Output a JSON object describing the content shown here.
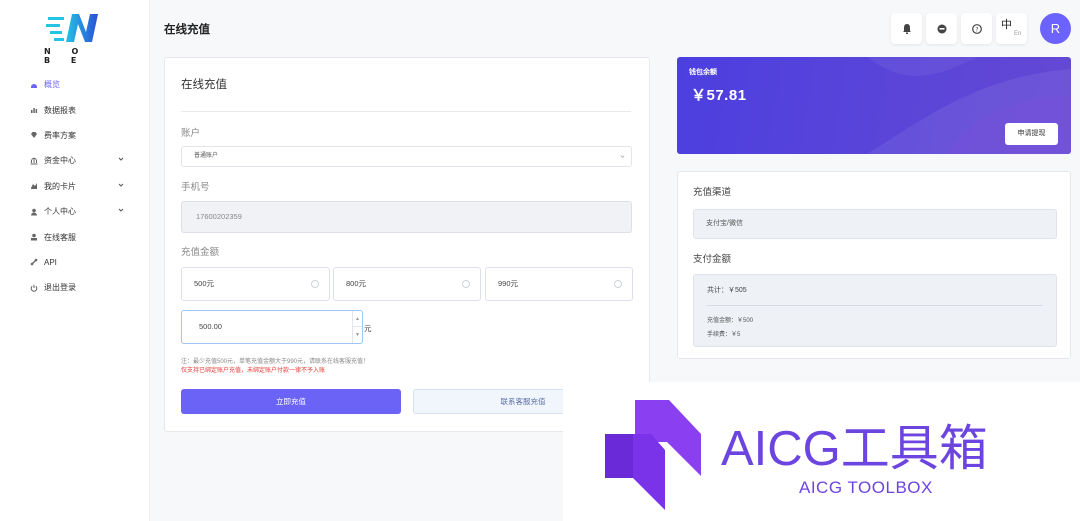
{
  "brand": {
    "logo_text": "N O B E"
  },
  "sidebar": {
    "items": [
      {
        "label": "概览",
        "icon": "dashboard-icon"
      },
      {
        "label": "数据报表",
        "icon": "bar-chart-icon"
      },
      {
        "label": "费率方案",
        "icon": "diamond-icon"
      },
      {
        "label": "资金中心",
        "icon": "bank-icon"
      },
      {
        "label": "我的卡片",
        "icon": "card-icon"
      },
      {
        "label": "个人中心",
        "icon": "user-icon"
      },
      {
        "label": "在线客服",
        "icon": "support-icon"
      },
      {
        "label": "API",
        "icon": "link-icon"
      },
      {
        "label": "退出登录",
        "icon": "power-icon"
      }
    ]
  },
  "header": {
    "title": "在线充值",
    "lang_zh": "中",
    "lang_en": "En",
    "avatar_initial": "R"
  },
  "recharge": {
    "title": "在线充值",
    "account_label": "账户",
    "account_value": "普通账户",
    "phone_label": "手机号",
    "phone_value": "17600202359",
    "amount_label": "充值金额",
    "amount_options": [
      "500元",
      "800元",
      "990元"
    ],
    "custom_amount": "500.00",
    "unit": "元",
    "note": "注：最少充值500元，单笔充值金额大于990元，请联系在线客服充值！",
    "warning": "仅支持已绑定账户充值，未绑定账户付款一律不予入账",
    "submit_label": "立即充值",
    "contact_label": "联系客服充值"
  },
  "wallet": {
    "label": "钱包余额",
    "balance": "￥57.81",
    "withdraw_label": "申请提现"
  },
  "payment": {
    "channel_label": "充值渠道",
    "channel_value": "支付宝/微信",
    "amount_label": "支付金额",
    "total": "共计：￥505",
    "recharge_amount": "充值金额：￥500",
    "fee": "手续费：￥5"
  },
  "watermark": {
    "title": "AICG工具箱",
    "subtitle": "AICG TOOLBOX"
  },
  "colors": {
    "accent": "#6a63f6",
    "wallet_bg": "#4c3fe0",
    "warning": "#e53935",
    "watermark": "#6c44e0"
  }
}
